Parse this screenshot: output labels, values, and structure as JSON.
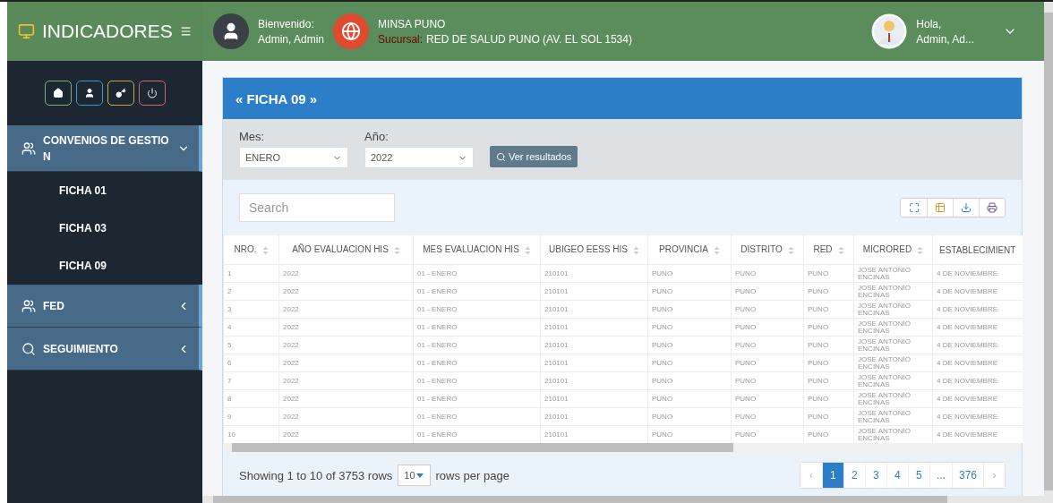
{
  "brand": {
    "title": "INDICADORES"
  },
  "welcome": {
    "label": "Bienvenido:",
    "name": "Admin, Admin"
  },
  "branch": {
    "title": "MINSA PUNO",
    "label": "Sucursal:",
    "value": "RED DE SALUD PUNO (AV. EL SOL 1534)"
  },
  "user": {
    "greeting": "Hola,",
    "name": "Admin, Ad..."
  },
  "quick_buttons": [
    {
      "kind": "home",
      "color": "#7fae7f"
    },
    {
      "kind": "user",
      "color": "#4f94c4"
    },
    {
      "kind": "key",
      "color": "#c8a94a"
    },
    {
      "kind": "power",
      "color": "#d06a6a"
    }
  ],
  "sidebar": {
    "items": [
      {
        "label": "CONVENIOS DE GESTION",
        "kind": "users",
        "expanded": true,
        "children": [
          {
            "label": "FICHA 01"
          },
          {
            "label": "FICHA 03"
          },
          {
            "label": "FICHA 09"
          }
        ]
      },
      {
        "label": "FED",
        "kind": "users",
        "expanded": false
      },
      {
        "label": "SEGUIMIENTO",
        "kind": "search",
        "expanded": false
      }
    ]
  },
  "card": {
    "title": "« FICHA 09 »"
  },
  "filters": {
    "month": {
      "label": "Mes:",
      "value": "ENERO"
    },
    "year": {
      "label": "Año:",
      "value": "2022"
    },
    "button": "Ver resultados"
  },
  "search": {
    "placeholder": "Search"
  },
  "table_tools": [
    {
      "kind": "fullscreen"
    },
    {
      "kind": "columns"
    },
    {
      "kind": "download"
    },
    {
      "kind": "print"
    }
  ],
  "table": {
    "columns": [
      "NRO.",
      "AÑO EVALUACION HIS",
      "MES EVALUACION HIS",
      "UBIGEO EESS HIS",
      "PROVINCIA",
      "DISTRITO",
      "RED",
      "MICRORED",
      "ESTABLECIMIENT"
    ],
    "rows": [
      [
        "1",
        "2022",
        "01 - ENERO",
        "210101",
        "PUNO",
        "PUNO",
        "PUNO",
        "JOSE ANTONIO ENCINAS",
        "4 DE NOVIEMBRE"
      ],
      [
        "2",
        "2022",
        "01 - ENERO",
        "210101",
        "PUNO",
        "PUNO",
        "PUNO",
        "JOSE ANTONIO ENCINAS",
        "4 DE NOVIEMBRE"
      ],
      [
        "3",
        "2022",
        "01 - ENERO",
        "210101",
        "PUNO",
        "PUNO",
        "PUNO",
        "JOSE ANTONIO ENCINAS",
        "4 DE NOVIEMBRE"
      ],
      [
        "4",
        "2022",
        "01 - ENERO",
        "210101",
        "PUNO",
        "PUNO",
        "PUNO",
        "JOSE ANTONIO ENCINAS",
        "4 DE NOVIEMBRE"
      ],
      [
        "5",
        "2022",
        "01 - ENERO",
        "210101",
        "PUNO",
        "PUNO",
        "PUNO",
        "JOSE ANTONIO ENCINAS",
        "4 DE NOVIEMBRE"
      ],
      [
        "6",
        "2022",
        "01 - ENERO",
        "210101",
        "PUNO",
        "PUNO",
        "PUNO",
        "JOSE ANTONIO ENCINAS",
        "4 DE NOVIEMBRE"
      ],
      [
        "7",
        "2022",
        "01 - ENERO",
        "210101",
        "PUNO",
        "PUNO",
        "PUNO",
        "JOSE ANTONIO ENCINAS",
        "4 DE NOVIEMBRE"
      ],
      [
        "8",
        "2022",
        "01 - ENERO",
        "210101",
        "PUNO",
        "PUNO",
        "PUNO",
        "JOSE ANTONIO ENCINAS",
        "4 DE NOVIEMBRE"
      ],
      [
        "9",
        "2022",
        "01 - ENERO",
        "210101",
        "PUNO",
        "PUNO",
        "PUNO",
        "JOSE ANTONIO ENCINAS",
        "4 DE NOVIEMBRE"
      ],
      [
        "10",
        "2022",
        "01 - ENERO",
        "210101",
        "PUNO",
        "PUNO",
        "PUNO",
        "JOSE ANTONIO ENCINAS",
        "4 DE NOVIEMBRE"
      ]
    ]
  },
  "footer": {
    "showing": "Showing 1 to 10 of 3753 rows",
    "page_size": "10",
    "per_page": "rows per page"
  },
  "pagination": {
    "prev": "‹",
    "next": "›",
    "pages": [
      {
        "label": "1",
        "selected": true
      },
      {
        "label": "2",
        "selected": false
      },
      {
        "label": "3",
        "selected": false
      },
      {
        "label": "4",
        "selected": false
      },
      {
        "label": "5",
        "selected": false
      },
      {
        "label": "...",
        "selected": false
      },
      {
        "label": "376",
        "selected": false
      }
    ]
  }
}
